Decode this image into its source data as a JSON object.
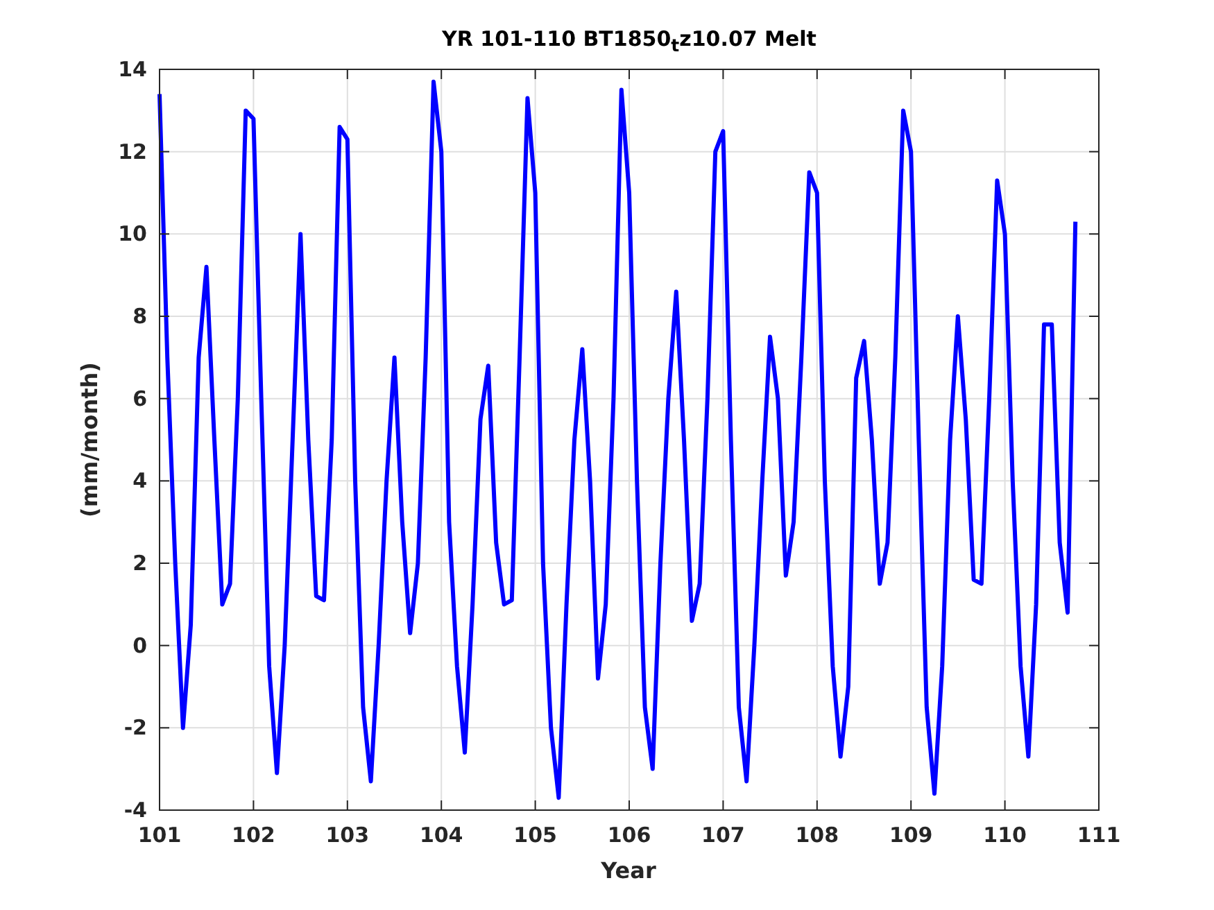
{
  "figure": {
    "chart_data": {
      "type": "line",
      "title": "YR 101-110 BT1850$_{t}$z10.07 Melt",
      "xlabel": "Year",
      "ylabel": "(mm/month)",
      "xlim": [
        101,
        111
      ],
      "ylim": [
        -4,
        14
      ],
      "xticks": [
        101,
        102,
        103,
        104,
        105,
        106,
        107,
        108,
        109,
        110,
        111
      ],
      "yticks": [
        -4,
        -2,
        0,
        2,
        4,
        6,
        8,
        10,
        12,
        14
      ],
      "x": [
        101,
        101.083,
        101.167,
        101.25,
        101.333,
        101.417,
        101.5,
        101.583,
        101.667,
        101.75,
        101.833,
        101.917,
        102,
        102.083,
        102.167,
        102.25,
        102.333,
        102.417,
        102.5,
        102.583,
        102.667,
        102.75,
        102.833,
        102.917,
        103,
        103.083,
        103.167,
        103.25,
        103.333,
        103.417,
        103.5,
        103.583,
        103.667,
        103.75,
        103.833,
        103.917,
        104,
        104.083,
        104.167,
        104.25,
        104.333,
        104.417,
        104.5,
        104.583,
        104.667,
        104.75,
        104.833,
        104.917,
        105,
        105.083,
        105.167,
        105.25,
        105.333,
        105.417,
        105.5,
        105.583,
        105.667,
        105.75,
        105.833,
        105.917,
        106,
        106.083,
        106.167,
        106.25,
        106.333,
        106.417,
        106.5,
        106.583,
        106.667,
        106.75,
        106.833,
        106.917,
        107,
        107.083,
        107.167,
        107.25,
        107.333,
        107.417,
        107.5,
        107.583,
        107.667,
        107.75,
        107.833,
        107.917,
        108,
        108.083,
        108.167,
        108.25,
        108.333,
        108.417,
        108.5,
        108.583,
        108.667,
        108.75,
        108.833,
        108.917,
        109,
        109.083,
        109.167,
        109.25,
        109.333,
        109.417,
        109.5,
        109.583,
        109.667,
        109.75,
        109.833,
        109.917,
        110,
        110.083,
        110.167,
        110.25,
        110.333,
        110.417,
        110.5,
        110.583,
        110.667,
        110.75
      ],
      "grid": true,
      "series": [
        {
          "color": "#0000ff",
          "values": [
            13.4,
            7,
            2,
            -2,
            0.5,
            7,
            9.2,
            5,
            1,
            1.5,
            6,
            13,
            12.8,
            6,
            -0.5,
            -3.1,
            0,
            5,
            10,
            5,
            1.2,
            1.1,
            5,
            12.6,
            12.3,
            4,
            -1.5,
            -3.3,
            0,
            4,
            7,
            3,
            0.3,
            2,
            7,
            13.7,
            12,
            3,
            -0.5,
            -2.6,
            1,
            5.5,
            6.8,
            2.5,
            1,
            1.1,
            7,
            13.3,
            11,
            2,
            -2,
            -3.7,
            1,
            5,
            7.2,
            4,
            -0.8,
            1,
            6,
            13.5,
            11,
            4,
            -1.5,
            -3,
            2,
            6,
            8.6,
            5,
            0.6,
            1.5,
            6,
            12,
            12.5,
            5,
            -1.5,
            -3.3,
            0,
            4,
            7.5,
            6,
            1.7,
            3,
            7,
            11.5,
            11,
            4,
            -0.5,
            -2.7,
            -1,
            6.5,
            7.4,
            5,
            1.5,
            2.5,
            7,
            13,
            12,
            5,
            -1.5,
            -3.6,
            -0.5,
            5,
            8,
            5.5,
            1.6,
            1.5,
            6,
            11.3,
            10,
            4,
            -0.5,
            -2.7,
            1,
            7.8,
            7.8,
            2.5,
            0.8,
            10.3
          ]
        }
      ]
    }
  }
}
